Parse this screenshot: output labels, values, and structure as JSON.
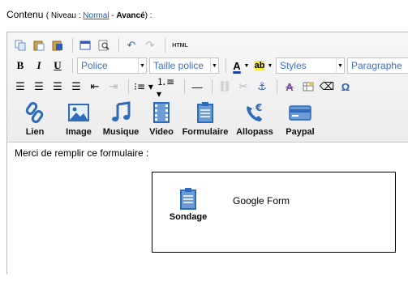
{
  "header": {
    "label": "Contenu",
    "open": "( Niveau : ",
    "link": "Normal",
    "dash": " - ",
    "advanced": "Avancé",
    "close": ") :"
  },
  "toolbar": {
    "html_label": "HTML",
    "bold": "B",
    "italic": "I",
    "underline": "U",
    "font_combo": "Police",
    "size_combo": "Taille police",
    "styles_combo": "Styles",
    "format_combo": "Paragraphe",
    "text_color_glyph": "A",
    "bg_color_glyph": "ab"
  },
  "plugins": [
    {
      "label": "Lien",
      "icon": "link-icon"
    },
    {
      "label": "Image",
      "icon": "image-icon"
    },
    {
      "label": "Musique",
      "icon": "music-icon"
    },
    {
      "label": "Video",
      "icon": "video-icon"
    },
    {
      "label": "Formulaire",
      "icon": "form-icon"
    },
    {
      "label": "Allopass",
      "icon": "phone-euro-icon"
    },
    {
      "label": "Paypal",
      "icon": "card-icon"
    }
  ],
  "content": {
    "paragraph": "Merci de remplir ce formulaire :",
    "form_icon_label": "Sondage",
    "form_title": "Google Form"
  },
  "colors": {
    "accent": "#2e6bb8",
    "link": "#1a5fb4",
    "combo_text": "#3b6fd0"
  }
}
